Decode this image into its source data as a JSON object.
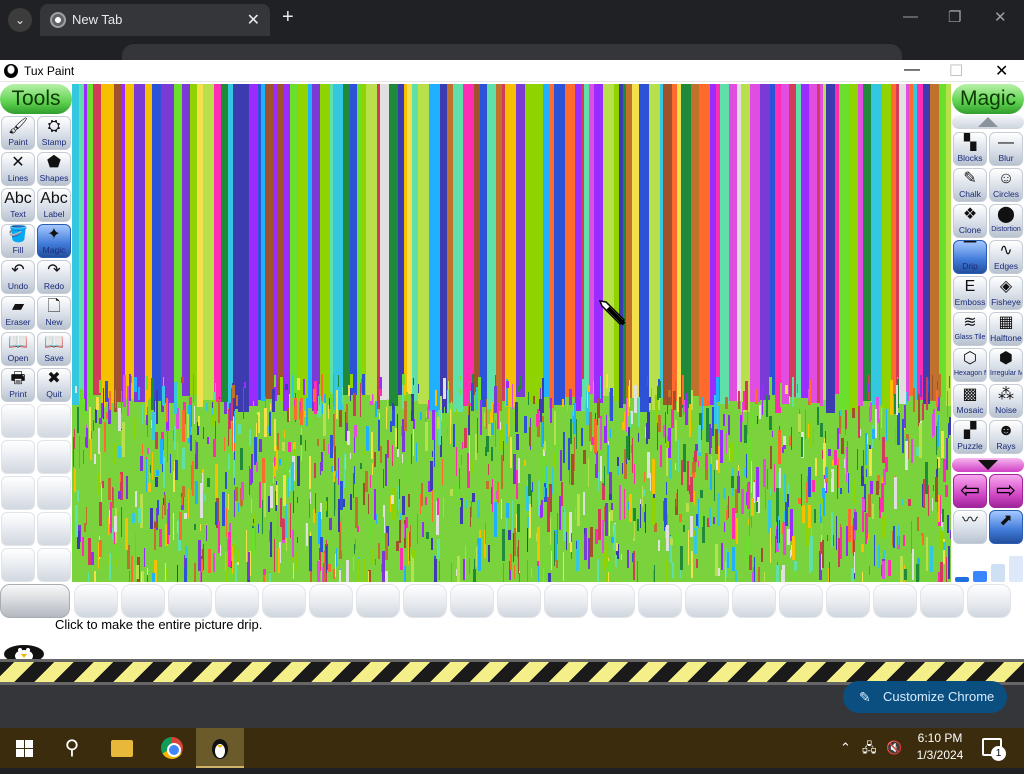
{
  "chrome": {
    "tab_title": "New Tab",
    "tab_close": "✕",
    "new_tab": "+",
    "minimize": "—",
    "restore": "❐",
    "close": "✕",
    "customize_label": "Customize Chrome"
  },
  "tuxpaint": {
    "window_title": "Tux Paint",
    "tools_header": "Tools",
    "magic_header": "Magic",
    "tools": [
      {
        "label": "Paint",
        "icon": "paintbrush-icon",
        "glyph": "🖌"
      },
      {
        "label": "Stamp",
        "icon": "stamp-icon",
        "glyph": "⛭"
      },
      {
        "label": "Lines",
        "icon": "lines-icon",
        "glyph": "✕"
      },
      {
        "label": "Shapes",
        "icon": "shapes-icon",
        "glyph": "⬟"
      },
      {
        "label": "Text",
        "icon": "text-icon",
        "glyph": "Abc"
      },
      {
        "label": "Label",
        "icon": "label-icon",
        "glyph": "Abc"
      },
      {
        "label": "Fill",
        "icon": "fill-bucket-icon",
        "glyph": "🪣"
      },
      {
        "label": "Magic",
        "icon": "magic-wand-icon",
        "glyph": "✦"
      },
      {
        "label": "Undo",
        "icon": "undo-icon",
        "glyph": "↶"
      },
      {
        "label": "Redo",
        "icon": "redo-icon",
        "glyph": "↷"
      },
      {
        "label": "Eraser",
        "icon": "eraser-icon",
        "glyph": "▰"
      },
      {
        "label": "New",
        "icon": "new-page-icon",
        "glyph": "🗋"
      },
      {
        "label": "Open",
        "icon": "open-icon",
        "glyph": "📖"
      },
      {
        "label": "Save",
        "icon": "save-icon",
        "glyph": "📖"
      },
      {
        "label": "Print",
        "icon": "print-icon",
        "glyph": "🖶"
      },
      {
        "label": "Quit",
        "icon": "quit-icon",
        "glyph": "✖"
      }
    ],
    "magic_tools": [
      {
        "label": "Blocks",
        "icon": "blocks-icon",
        "glyph": "▚"
      },
      {
        "label": "Blur",
        "icon": "blur-icon",
        "glyph": "—"
      },
      {
        "label": "Chalk",
        "icon": "chalk-icon",
        "glyph": "✎"
      },
      {
        "label": "Circles",
        "icon": "circles-icon",
        "glyph": "☺"
      },
      {
        "label": "Clone",
        "icon": "clone-icon",
        "glyph": "❖"
      },
      {
        "label": "Distortion",
        "icon": "distortion-icon",
        "glyph": "⬤"
      },
      {
        "label": "Drip",
        "icon": "drip-icon",
        "glyph": "▔"
      },
      {
        "label": "Edges",
        "icon": "edges-icon",
        "glyph": "∿"
      },
      {
        "label": "Emboss",
        "icon": "emboss-icon",
        "glyph": "E"
      },
      {
        "label": "Fisheye",
        "icon": "fisheye-icon",
        "glyph": "◈"
      },
      {
        "label": "Glass Tile",
        "icon": "glass-tile-icon",
        "glyph": "≋"
      },
      {
        "label": "Halftone",
        "icon": "halftone-icon",
        "glyph": "▦"
      },
      {
        "label": "Hexagon Mosaic",
        "icon": "hexagon-mosaic-icon",
        "glyph": "⬡"
      },
      {
        "label": "Irregular Mosaic",
        "icon": "irregular-mosaic-icon",
        "glyph": "⬢"
      },
      {
        "label": "Mosaic",
        "icon": "mosaic-icon",
        "glyph": "▩"
      },
      {
        "label": "Noise",
        "icon": "noise-icon",
        "glyph": "⁂"
      },
      {
        "label": "Puzzle",
        "icon": "puzzle-icon",
        "glyph": "▞"
      },
      {
        "label": "Rays",
        "icon": "rays-icon",
        "glyph": "☻"
      }
    ],
    "status_text": "Click to make the entire picture drip.",
    "colors": {
      "canvas_stripes": [
        "#8fd400",
        "#e04de0",
        "#34c7e0",
        "#f6c000",
        "#7b39d6",
        "#1f8a3a",
        "#ff6b2c",
        "#2c52d8",
        "#b8e04a",
        "#d23c5a",
        "#5fe0a8",
        "#9a2cff",
        "#f4e04a",
        "#1fb0ff",
        "#c0712c",
        "#6adf2c",
        "#ff2cb4",
        "#3c3cb0",
        "#e0e0e0",
        "#a0522d"
      ]
    }
  },
  "taskbar": {
    "time": "6:10 PM",
    "date": "1/3/2024",
    "notif_count": "1"
  }
}
